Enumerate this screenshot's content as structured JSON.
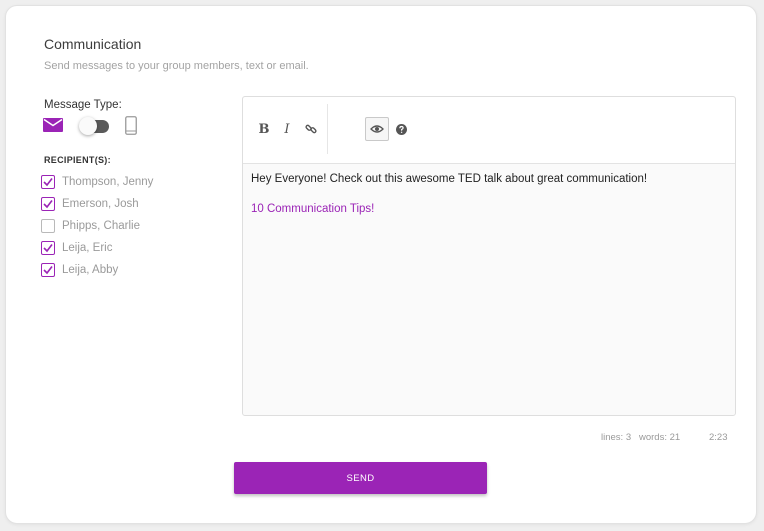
{
  "header": {
    "title": "Communication",
    "subtitle": "Send messages to your group members, text or email."
  },
  "message_type": {
    "label": "Message Type:",
    "options": [
      "email-icon",
      "phone-icon"
    ],
    "selected": "email"
  },
  "recipients": {
    "label": "RECIPIENT(S):",
    "items": [
      {
        "name": "Thompson, Jenny",
        "checked": true
      },
      {
        "name": "Emerson, Josh",
        "checked": true
      },
      {
        "name": "Phipps, Charlie",
        "checked": false
      },
      {
        "name": "Leija, Eric",
        "checked": true
      },
      {
        "name": "Leija, Abby",
        "checked": true
      }
    ]
  },
  "editor": {
    "toolbar": {
      "bold": "B",
      "italic": "I",
      "link_icon": "link-icon",
      "preview_icon": "eye-icon",
      "help_icon": "question-circle-icon"
    },
    "content": {
      "line1": "Hey Everyone! Check out this awesome TED talk about great communication!",
      "link_text": "10 Communication Tips!"
    }
  },
  "status": {
    "lines": "lines: 3",
    "words": "words: 21",
    "time": "2:23"
  },
  "send_label": "SEND",
  "colors": {
    "accent": "#9b24b6",
    "muted_text": "#9a9a9a",
    "background": "#efefef"
  }
}
